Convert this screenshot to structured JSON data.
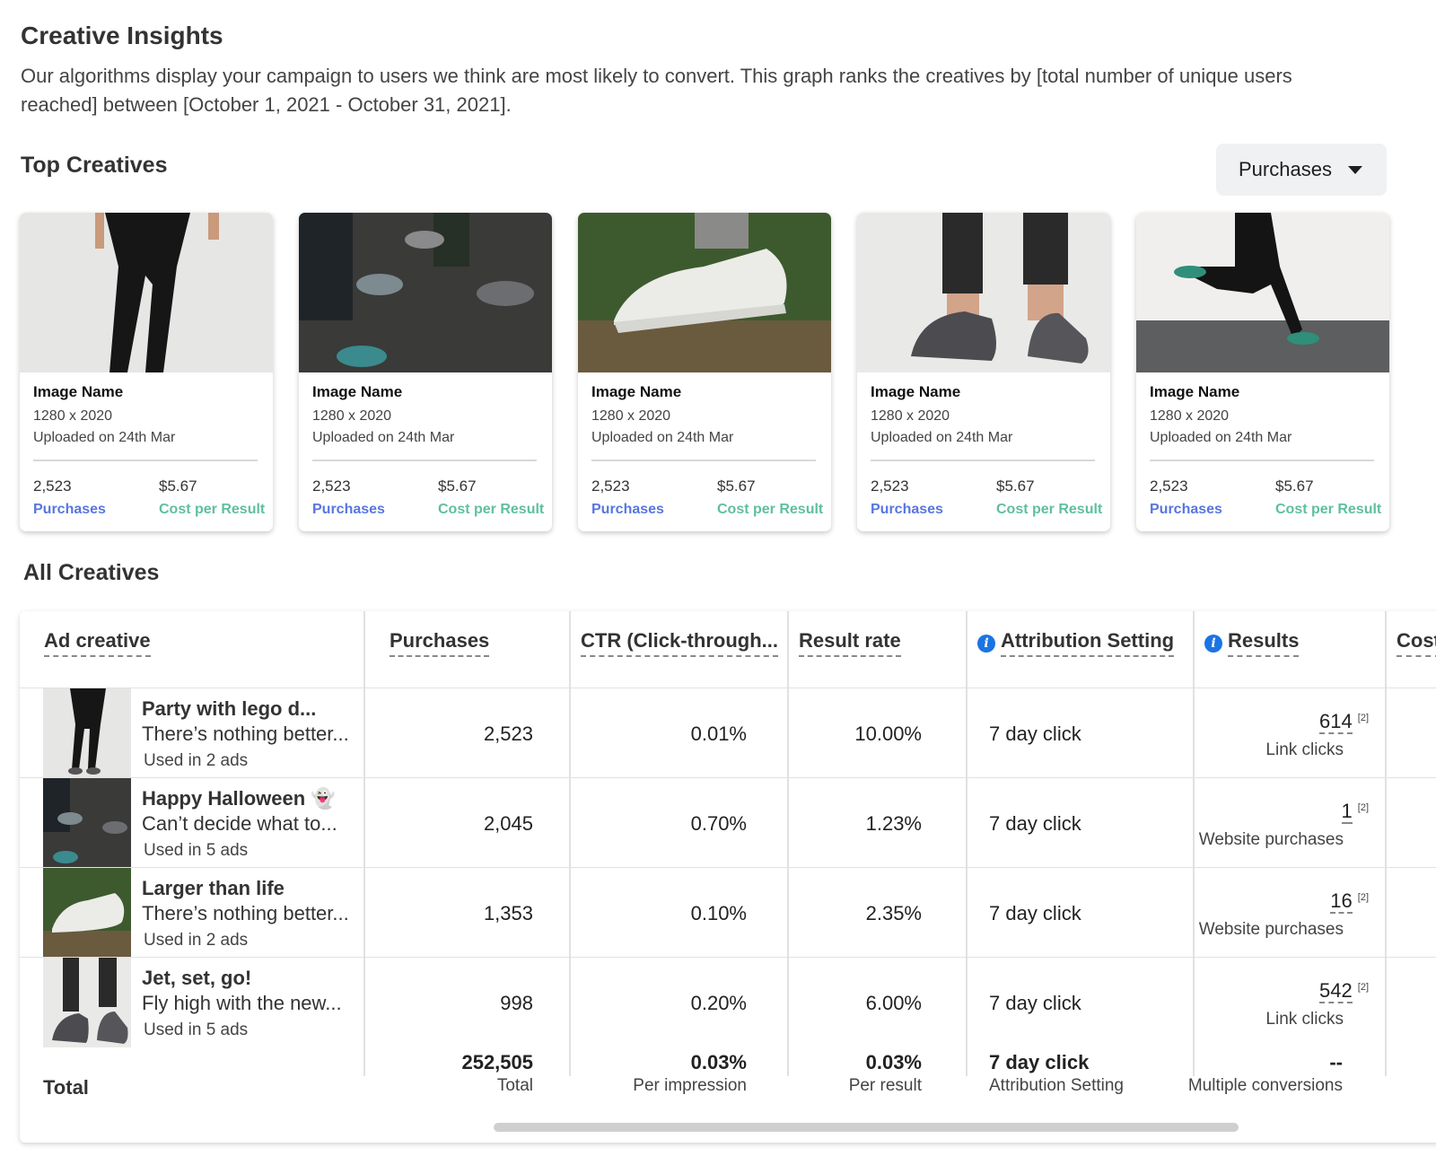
{
  "header": {
    "title": "Creative Insights",
    "description": "Our algorithms display your campaign to users we think are most likely to convert. This graph ranks the creatives  by [total number of unique users reached] between [October 1, 2021 - October 31, 2021]."
  },
  "top_creatives": {
    "title": "Top Creatives",
    "dropdown_value": "Purchases",
    "cards": [
      {
        "name": "Image Name",
        "dimensions": "1280 x 2020",
        "uploaded": "Uploaded on 24th Mar",
        "value": "2,523",
        "value_label": "Purchases",
        "cost": "$5.67",
        "cost_label": "Cost per Result"
      },
      {
        "name": "Image Name",
        "dimensions": "1280 x 2020",
        "uploaded": "Uploaded on 24th Mar",
        "value": "2,523",
        "value_label": "Purchases",
        "cost": "$5.67",
        "cost_label": "Cost per Result"
      },
      {
        "name": "Image Name",
        "dimensions": "1280 x 2020",
        "uploaded": "Uploaded on 24th Mar",
        "value": "2,523",
        "value_label": "Purchases",
        "cost": "$5.67",
        "cost_label": "Cost per Result"
      },
      {
        "name": "Image Name",
        "dimensions": "1280 x 2020",
        "uploaded": "Uploaded on 24th Mar",
        "value": "2,523",
        "value_label": "Purchases",
        "cost": "$5.67",
        "cost_label": "Cost per Result"
      },
      {
        "name": "Image Name",
        "dimensions": "1280 x 2020",
        "uploaded": "Uploaded on 24th Mar",
        "value": "2,523",
        "value_label": "Purchases",
        "cost": "$5.67",
        "cost_label": "Cost per Result"
      }
    ]
  },
  "all_creatives": {
    "title": "All Creatives",
    "columns": {
      "ad_creative": "Ad creative",
      "purchases": "Purchases",
      "ctr": "CTR (Click-through...",
      "result_rate": "Result rate",
      "attribution": "Attribution Setting",
      "results": "Results",
      "cost": "Cost"
    },
    "rows": [
      {
        "title": "Party with lego d...",
        "subtitle": "There’s nothing better...",
        "used": "Used in 2 ads",
        "purchases": "2,523",
        "ctr": "0.01%",
        "result_rate": "10.00%",
        "attribution": "7 day click",
        "results": "614",
        "results_sup": "[2]",
        "results_label": "Link clicks"
      },
      {
        "title": "Happy Halloween 👻",
        "subtitle": "Can’t decide what to...",
        "used": "Used in 5 ads",
        "purchases": "2,045",
        "ctr": "0.70%",
        "result_rate": "1.23%",
        "attribution": "7 day click",
        "results": "1",
        "results_sup": "[2]",
        "results_label": "Website purchases"
      },
      {
        "title": "Larger than life",
        "subtitle": "There’s nothing better...",
        "used": "Used in 2 ads",
        "purchases": "1,353",
        "ctr": "0.10%",
        "result_rate": "2.35%",
        "attribution": "7 day click",
        "results": "16",
        "results_sup": "[2]",
        "results_label": "Website purchases"
      },
      {
        "title": "Jet, set, go!",
        "subtitle": "Fly high with the new...",
        "used": "Used in 5 ads",
        "purchases": "998",
        "ctr": "0.20%",
        "result_rate": "6.00%",
        "attribution": "7 day click",
        "results": "542",
        "results_sup": "[2]",
        "results_label": "Link clicks"
      }
    ],
    "total": {
      "label": "Total",
      "purchases": "252,505",
      "purchases_sub": "Total",
      "ctr": "0.03%",
      "ctr_sub": "Per impression",
      "result_rate": "0.03%",
      "result_rate_sub": "Per result",
      "attribution": "7 day click",
      "attribution_sub": "Attribution Setting",
      "results": "--",
      "results_sub": "Multiple conversions"
    }
  },
  "colors": {
    "purchases_label": "#5876e0",
    "cost_label": "#5fbf9f",
    "info_icon": "#1b74e4"
  }
}
